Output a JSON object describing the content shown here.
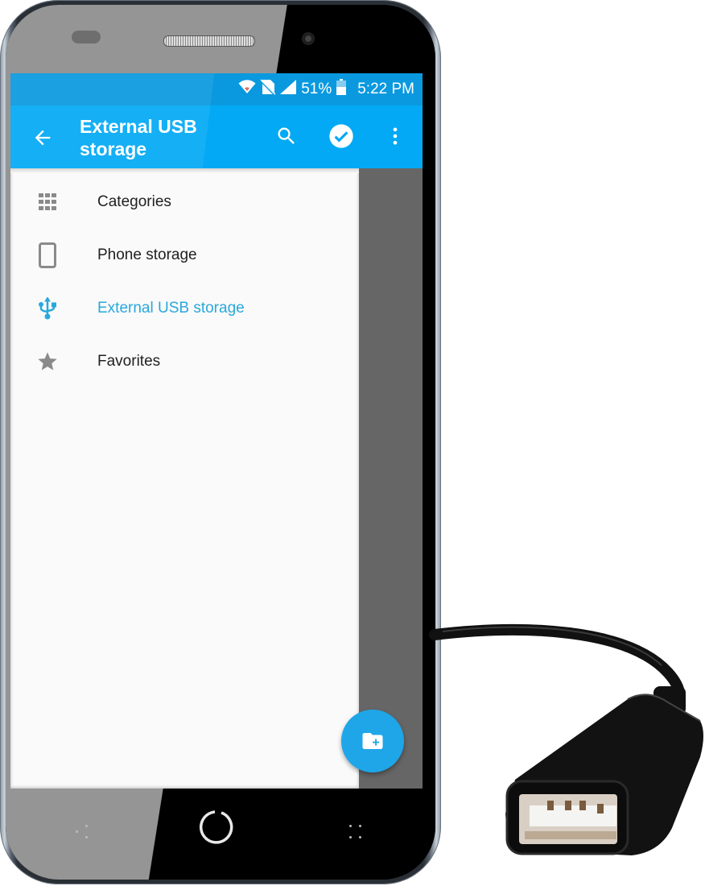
{
  "status_bar": {
    "icons": [
      "wifi-icon",
      "no-sim-icon",
      "signal-icon",
      "battery-icon"
    ],
    "battery_percent": "51%",
    "time": "5:22 PM"
  },
  "app_bar": {
    "title": "External USB storage",
    "back_icon": "arrow-back-icon",
    "actions": [
      {
        "name": "search",
        "icon": "search-icon"
      },
      {
        "name": "select",
        "icon": "check-circle-icon"
      },
      {
        "name": "more",
        "icon": "more-vert-icon"
      }
    ]
  },
  "drawer": {
    "items": [
      {
        "label": "Categories",
        "icon": "grid-icon",
        "active": false
      },
      {
        "label": "Phone storage",
        "icon": "phone-icon",
        "active": false
      },
      {
        "label": "External USB storage",
        "icon": "usb-icon",
        "active": true
      },
      {
        "label": "Favorites",
        "icon": "star-icon",
        "active": false
      }
    ]
  },
  "fab": {
    "icon": "create-folder-icon",
    "action": "New folder"
  },
  "colors": {
    "status_bar": "#0a99df",
    "app_bar": "#03a9f4",
    "accent": "#29a8dc",
    "fab": "#1ea6e8",
    "scrim": "#666666"
  }
}
